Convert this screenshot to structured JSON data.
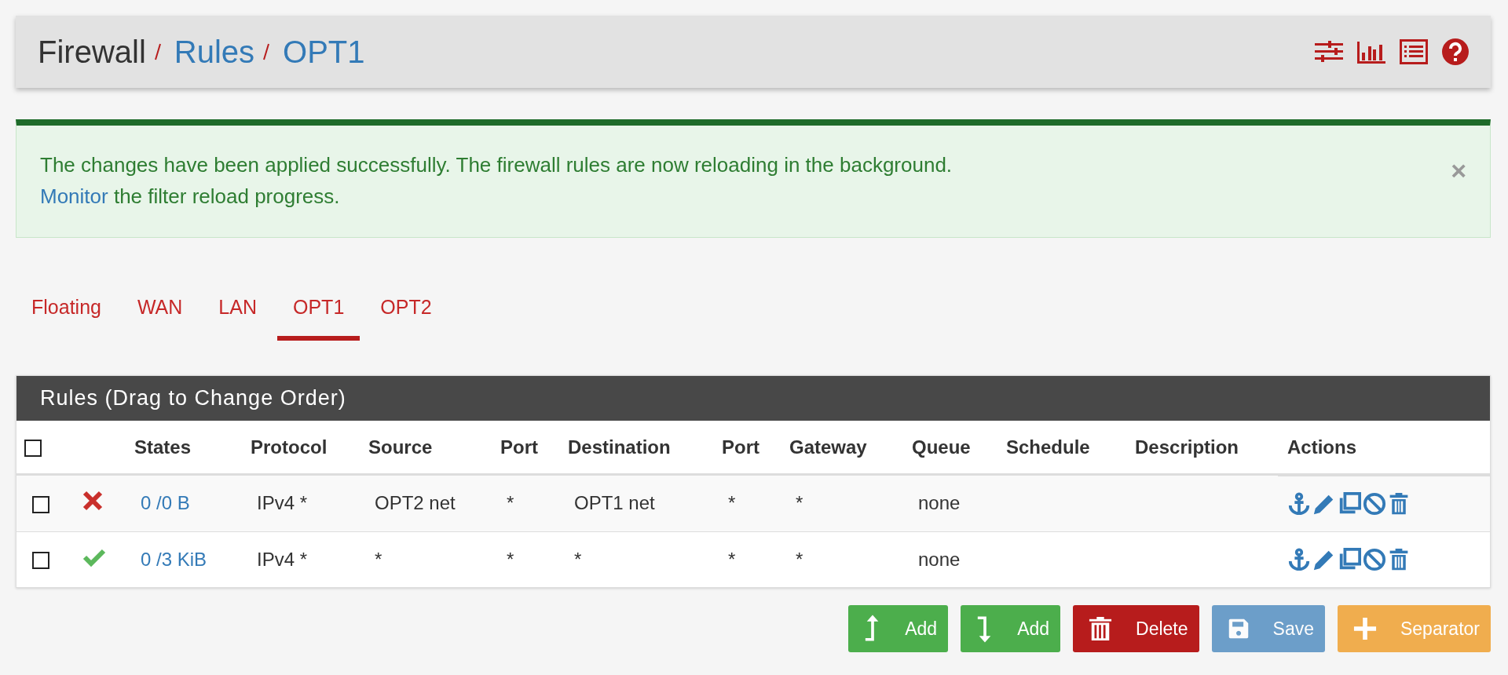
{
  "breadcrumb": [
    {
      "label": "Firewall",
      "link": false
    },
    {
      "label": "Rules",
      "link": true
    },
    {
      "label": "OPT1",
      "link": true
    }
  ],
  "alert": {
    "message": "The changes have been applied successfully. The firewall rules are now reloading in the background.",
    "link": "Monitor",
    "link_suffix": " the filter reload progress.",
    "close": "×"
  },
  "tabs": [
    {
      "label": "Floating",
      "selected": false
    },
    {
      "label": "WAN",
      "selected": false
    },
    {
      "label": "LAN",
      "selected": false
    },
    {
      "label": "OPT1",
      "selected": true
    },
    {
      "label": "OPT2",
      "selected": false
    }
  ],
  "panel": {
    "title": "Rules (Drag to Change Order)"
  },
  "table": {
    "select_all": false,
    "columns": [
      "States",
      "Protocol",
      "Source",
      "Port",
      "Destination",
      "Port",
      "Gateway",
      "Queue",
      "Schedule",
      "Description",
      "Actions"
    ],
    "rows": [
      {
        "checked": false,
        "kind": "block",
        "states": "0 /0 B",
        "protocol": "IPv4 *",
        "source": "OPT2 net",
        "source_port": "*",
        "destination": "OPT1 net",
        "destination_port": "*",
        "gateway": "*",
        "queue": "none"
      },
      {
        "checked": false,
        "kind": "pass",
        "states": "0 /3 KiB",
        "protocol": "IPv4 *",
        "source": "*",
        "source_port": "*",
        "destination": "*",
        "destination_port": "*",
        "gateway": "*",
        "queue": "none"
      }
    ]
  },
  "buttons": [
    {
      "kind": "add-top",
      "label": "Add",
      "disabled": false
    },
    {
      "kind": "add-bottom",
      "label": "Add",
      "disabled": false
    },
    {
      "kind": "delete",
      "label": "Delete",
      "disabled": false
    },
    {
      "kind": "save",
      "label": "Save",
      "disabled": true
    },
    {
      "kind": "separator",
      "label": "Separator",
      "disabled": false
    }
  ]
}
